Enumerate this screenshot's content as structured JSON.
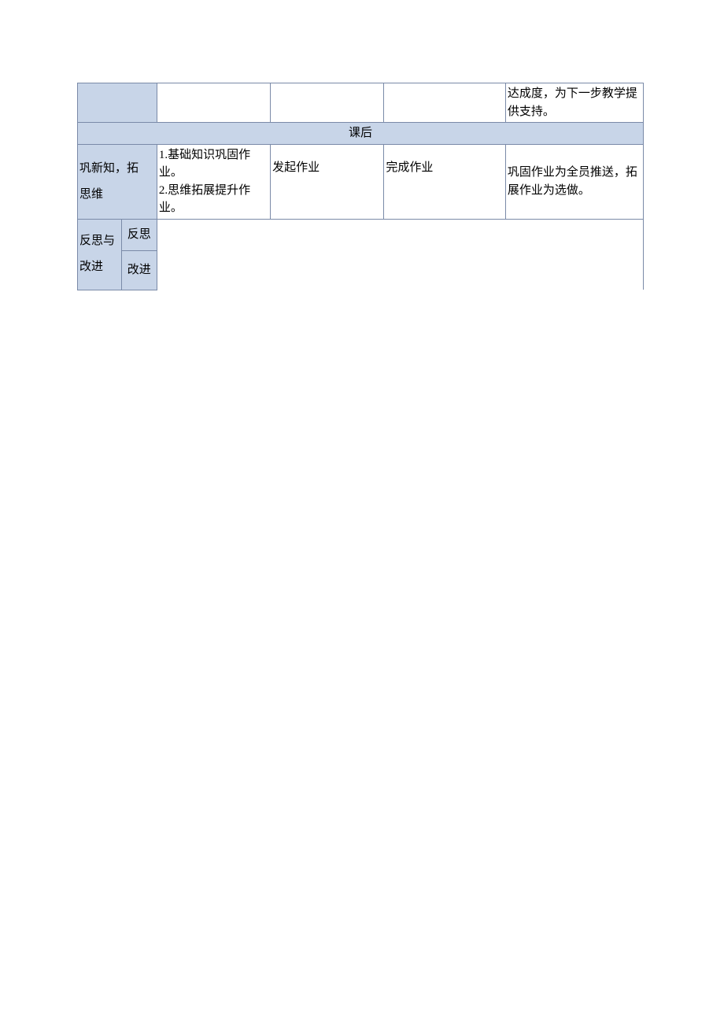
{
  "table": {
    "row1": {
      "col1": "",
      "col2": "",
      "col3": "",
      "col4": "",
      "col5": "达成度，为下一步教学提供支持。"
    },
    "header": "课后",
    "row3": {
      "col1": "巩新知，拓\n思维",
      "col2": "1.基础知识巩固作业。\n2.思维拓展提升作业。",
      "col3": "发起作业",
      "col4": "完成作业",
      "col5": "巩固作业为全员推送，拓展作业为选做。"
    },
    "row4": {
      "label": "反思与改进",
      "sub1": "反思",
      "sub2": "改进",
      "content": ""
    }
  }
}
